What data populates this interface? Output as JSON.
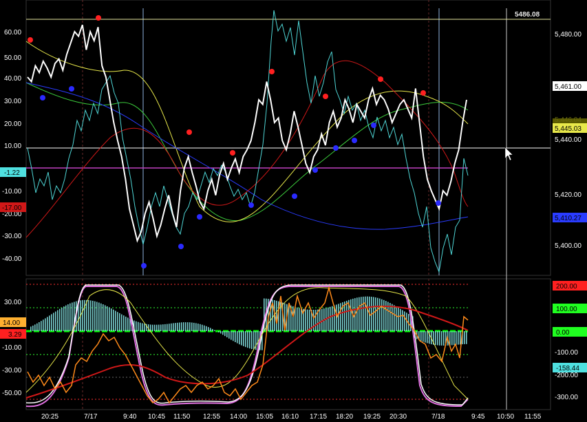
{
  "chart_data": {
    "type": "line",
    "top_panel": {
      "left_axis_ticks": [
        "60.00",
        "50.00",
        "40.00",
        "30.00",
        "20.00",
        "10.00",
        "-10.00",
        "-20.00",
        "-30.00",
        "-40.00"
      ],
      "left_axis_values": [
        60,
        50,
        40,
        30,
        20,
        10,
        -10,
        -20,
        -30,
        -40
      ],
      "right_axis_ticks": [
        "5,480.00",
        "5,461.00",
        "5,440.00",
        "5,420.00",
        "5,400.00"
      ],
      "right_axis_values": [
        5480,
        5461,
        5440,
        5420,
        5400
      ],
      "crosshair_price": "5486.08",
      "last_price_tag": "5,461.00",
      "left_tags": [
        "-1.22",
        "-17.00"
      ],
      "right_tags": [
        "5,445.03",
        "5,446.04",
        "5,410.27"
      ],
      "colors": {
        "oscillator": "#ffffff",
        "oscillator_fast": "#4fd6d6",
        "ma_yellow": "#e8e84a",
        "ma_green": "#3ccc3c",
        "ma_blue": "#2a3cff",
        "ma_red": "#d01818",
        "high_dot": "#ff2020",
        "low_dot": "#2a2aff",
        "zero_line": "#c040c0"
      },
      "white_series": [
        40,
        38,
        45,
        42,
        47,
        44,
        40,
        46,
        48,
        43,
        50,
        55,
        60,
        58,
        63,
        52,
        60,
        56,
        62,
        45,
        40,
        30,
        20,
        12,
        5,
        -5,
        -18,
        -25,
        -32,
        -28,
        -20,
        -15,
        -22,
        -30,
        -25,
        -18,
        -12,
        -20,
        -26,
        -10,
        0,
        5,
        -2,
        -8,
        -15,
        -18,
        -10,
        -5,
        -12,
        -3,
        2,
        -5,
        0,
        4,
        -2,
        5,
        8,
        12,
        20,
        30,
        28,
        38,
        30,
        20,
        22,
        12,
        8,
        15,
        25,
        18,
        10,
        2,
        -2,
        5,
        8,
        15,
        10,
        20,
        25,
        18,
        22,
        30,
        26,
        20,
        28,
        25,
        22,
        30,
        35,
        28,
        32,
        30,
        26,
        20,
        24,
        28,
        30,
        26,
        22,
        35,
        20,
        5,
        -5,
        -10,
        -14,
        -18,
        -10,
        -12,
        -6,
        2,
        8,
        20,
        30
      ]
    },
    "bottom_panel": {
      "left_axis_ticks": [
        "30.00",
        "10.00",
        "-10.00",
        "-30.00",
        "-50.00"
      ],
      "left_axis_values": [
        30,
        10,
        -10,
        -30,
        -50
      ],
      "right_axis_ticks": [
        "200.00",
        "100.00",
        "0.00",
        "-100.00",
        "-200.00",
        "-300.00"
      ],
      "right_axis_values": [
        200,
        100,
        0,
        -100,
        -200,
        -300
      ],
      "left_tags": [
        "14.00",
        "3.29"
      ],
      "right_tags": [
        "200.00",
        "100.00",
        "0.00",
        "-158.44"
      ],
      "colors": {
        "histogram": "#7ad0d0",
        "stoch": "#ffffff",
        "stoch_pink": "#e070e0",
        "cci": "#ff8a1a",
        "slow": "#d01818",
        "signal": "#e8e84a",
        "zero": "#00ff00"
      }
    },
    "x_ticks": [
      "20:25",
      "7/17",
      "9:40",
      "10:45",
      "11:50",
      "12:55",
      "14:00",
      "15:05",
      "16:10",
      "17:15",
      "18:20",
      "19:25",
      "20:30",
      "7/18",
      "9:45",
      "10:50",
      "11:55"
    ],
    "title": "",
    "xlabel": "",
    "ylabel": ""
  }
}
